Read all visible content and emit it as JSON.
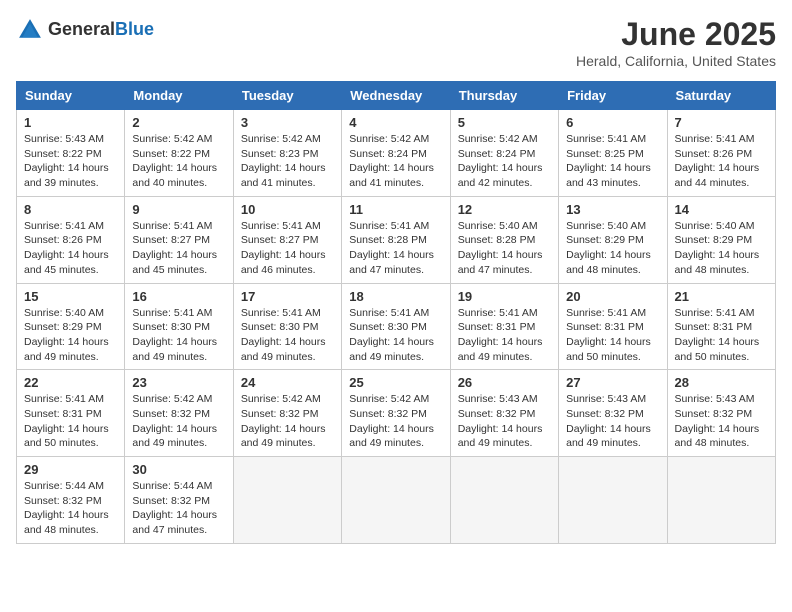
{
  "header": {
    "logo_general": "General",
    "logo_blue": "Blue",
    "month": "June 2025",
    "location": "Herald, California, United States"
  },
  "weekdays": [
    "Sunday",
    "Monday",
    "Tuesday",
    "Wednesday",
    "Thursday",
    "Friday",
    "Saturday"
  ],
  "weeks": [
    [
      {
        "day": "1",
        "sunrise": "5:43 AM",
        "sunset": "8:22 PM",
        "daylight": "14 hours and 39 minutes."
      },
      {
        "day": "2",
        "sunrise": "5:42 AM",
        "sunset": "8:22 PM",
        "daylight": "14 hours and 40 minutes."
      },
      {
        "day": "3",
        "sunrise": "5:42 AM",
        "sunset": "8:23 PM",
        "daylight": "14 hours and 41 minutes."
      },
      {
        "day": "4",
        "sunrise": "5:42 AM",
        "sunset": "8:24 PM",
        "daylight": "14 hours and 41 minutes."
      },
      {
        "day": "5",
        "sunrise": "5:42 AM",
        "sunset": "8:24 PM",
        "daylight": "14 hours and 42 minutes."
      },
      {
        "day": "6",
        "sunrise": "5:41 AM",
        "sunset": "8:25 PM",
        "daylight": "14 hours and 43 minutes."
      },
      {
        "day": "7",
        "sunrise": "5:41 AM",
        "sunset": "8:26 PM",
        "daylight": "14 hours and 44 minutes."
      }
    ],
    [
      {
        "day": "8",
        "sunrise": "5:41 AM",
        "sunset": "8:26 PM",
        "daylight": "14 hours and 45 minutes."
      },
      {
        "day": "9",
        "sunrise": "5:41 AM",
        "sunset": "8:27 PM",
        "daylight": "14 hours and 45 minutes."
      },
      {
        "day": "10",
        "sunrise": "5:41 AM",
        "sunset": "8:27 PM",
        "daylight": "14 hours and 46 minutes."
      },
      {
        "day": "11",
        "sunrise": "5:41 AM",
        "sunset": "8:28 PM",
        "daylight": "14 hours and 47 minutes."
      },
      {
        "day": "12",
        "sunrise": "5:40 AM",
        "sunset": "8:28 PM",
        "daylight": "14 hours and 47 minutes."
      },
      {
        "day": "13",
        "sunrise": "5:40 AM",
        "sunset": "8:29 PM",
        "daylight": "14 hours and 48 minutes."
      },
      {
        "day": "14",
        "sunrise": "5:40 AM",
        "sunset": "8:29 PM",
        "daylight": "14 hours and 48 minutes."
      }
    ],
    [
      {
        "day": "15",
        "sunrise": "5:40 AM",
        "sunset": "8:29 PM",
        "daylight": "14 hours and 49 minutes."
      },
      {
        "day": "16",
        "sunrise": "5:41 AM",
        "sunset": "8:30 PM",
        "daylight": "14 hours and 49 minutes."
      },
      {
        "day": "17",
        "sunrise": "5:41 AM",
        "sunset": "8:30 PM",
        "daylight": "14 hours and 49 minutes."
      },
      {
        "day": "18",
        "sunrise": "5:41 AM",
        "sunset": "8:30 PM",
        "daylight": "14 hours and 49 minutes."
      },
      {
        "day": "19",
        "sunrise": "5:41 AM",
        "sunset": "8:31 PM",
        "daylight": "14 hours and 49 minutes."
      },
      {
        "day": "20",
        "sunrise": "5:41 AM",
        "sunset": "8:31 PM",
        "daylight": "14 hours and 50 minutes."
      },
      {
        "day": "21",
        "sunrise": "5:41 AM",
        "sunset": "8:31 PM",
        "daylight": "14 hours and 50 minutes."
      }
    ],
    [
      {
        "day": "22",
        "sunrise": "5:41 AM",
        "sunset": "8:31 PM",
        "daylight": "14 hours and 50 minutes."
      },
      {
        "day": "23",
        "sunrise": "5:42 AM",
        "sunset": "8:32 PM",
        "daylight": "14 hours and 49 minutes."
      },
      {
        "day": "24",
        "sunrise": "5:42 AM",
        "sunset": "8:32 PM",
        "daylight": "14 hours and 49 minutes."
      },
      {
        "day": "25",
        "sunrise": "5:42 AM",
        "sunset": "8:32 PM",
        "daylight": "14 hours and 49 minutes."
      },
      {
        "day": "26",
        "sunrise": "5:43 AM",
        "sunset": "8:32 PM",
        "daylight": "14 hours and 49 minutes."
      },
      {
        "day": "27",
        "sunrise": "5:43 AM",
        "sunset": "8:32 PM",
        "daylight": "14 hours and 49 minutes."
      },
      {
        "day": "28",
        "sunrise": "5:43 AM",
        "sunset": "8:32 PM",
        "daylight": "14 hours and 48 minutes."
      }
    ],
    [
      {
        "day": "29",
        "sunrise": "5:44 AM",
        "sunset": "8:32 PM",
        "daylight": "14 hours and 48 minutes."
      },
      {
        "day": "30",
        "sunrise": "5:44 AM",
        "sunset": "8:32 PM",
        "daylight": "14 hours and 47 minutes."
      },
      null,
      null,
      null,
      null,
      null
    ]
  ]
}
